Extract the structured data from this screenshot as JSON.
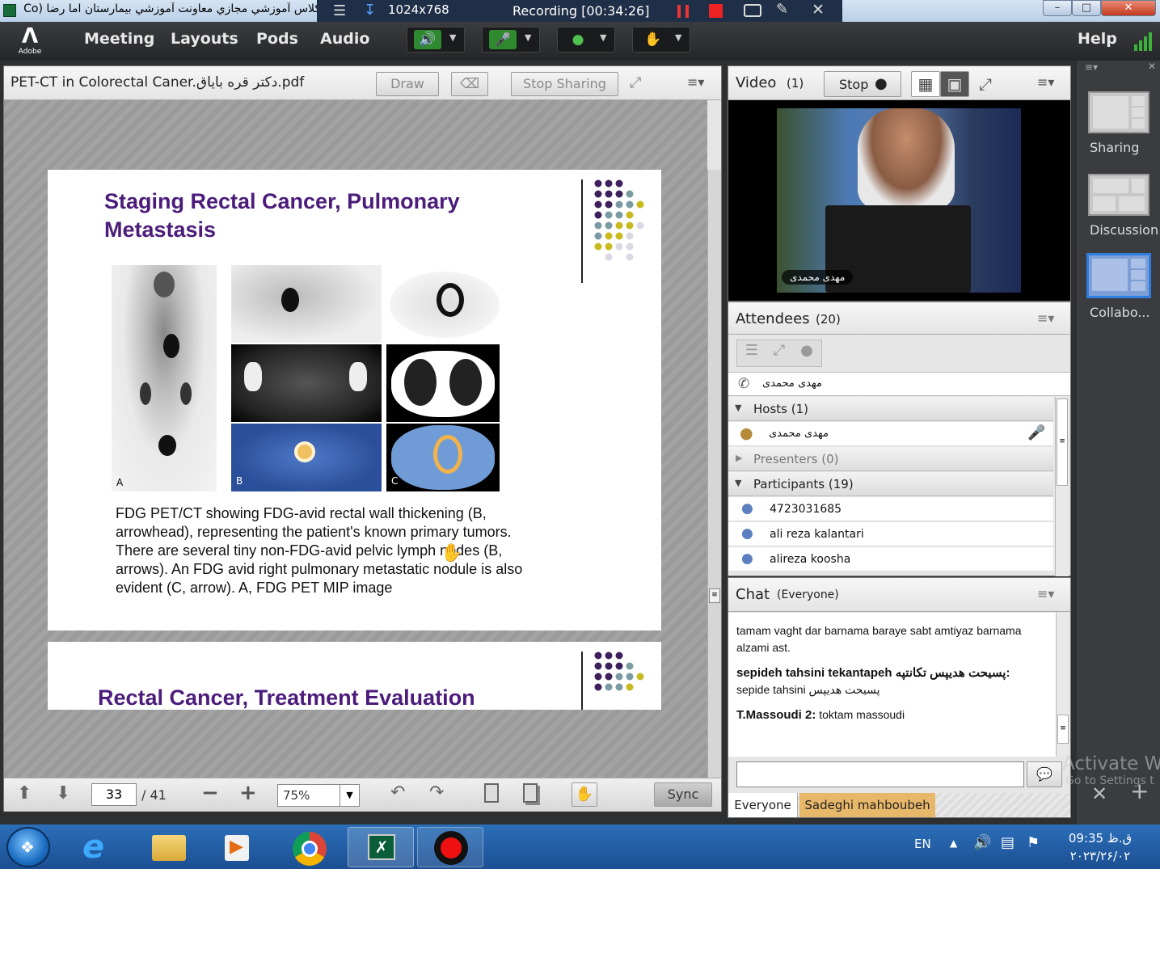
{
  "window": {
    "title": "كلاس آموزشي مجازي معاونت آموزشي بيمارستان اما رضا (Co",
    "resolution": "1024x768",
    "recording": "Recording [00:34:26]"
  },
  "menu": {
    "logo_text": "Adobe",
    "items": [
      "Meeting",
      "Layouts",
      "Pods",
      "Audio"
    ],
    "help": "Help"
  },
  "share_pod": {
    "title": "PET-CT in Colorectal Caner.دکتر قره باياق.pdf",
    "draw": "Draw",
    "stop_sharing": "Stop Sharing",
    "slide1": {
      "title_line1": "Staging Rectal Cancer, Pulmonary",
      "title_line2": "Metastasis",
      "label_a": "A",
      "label_b": "B",
      "label_c": "C",
      "caption_line1": "FDG PET/CT showing FDG-avid rectal wall thickening (B,",
      "caption_line2": "arrowhead), representing the patient's known primary tumors.",
      "caption_line3": "There are several tiny non-FDG-avid pelvic lymph nodes (B,",
      "caption_line4": "arrows). An FDG avid right pulmonary metastatic nodule is also",
      "caption_line5": "evident (C, arrow). A, FDG PET MIP image"
    },
    "slide2": {
      "title": "Rectal Cancer, Treatment Evaluation"
    },
    "page": "33",
    "total_pages": "/ 41",
    "zoom": "75%",
    "sync": "Sync"
  },
  "video_pod": {
    "title": "Video",
    "count": "(1)",
    "stop": "Stop",
    "name_tag": "مهدی محمدی"
  },
  "attendees_pod": {
    "title": "Attendees",
    "count": "(20)",
    "phone_user": "مهدی محمدی",
    "hosts": "Hosts (1)",
    "host_name": "مهدی محمدی",
    "presenters": "Presenters (0)",
    "participants": "Participants (19)",
    "participant_list": [
      "4723031685",
      "ali reza kalantari",
      "alireza koosha"
    ]
  },
  "chat_pod": {
    "title": "Chat",
    "scope": "(Everyone)",
    "messages": [
      {
        "sender": "",
        "text": "tamam vaght dar barnama baraye sabt amtiyaz barnama alzami ast."
      },
      {
        "sender": "sepideh tahsini tekantapeh پسيحت هدیپس تکانتپه:",
        "text": "sepide tahsini پسيحت هدیپس"
      },
      {
        "sender": "T.Massoudi 2:",
        "text": "toktam massoudi"
      }
    ],
    "tab_everyone": "Everyone",
    "tab_private": "Sadeghi mahboubeh"
  },
  "layouts_panel": {
    "items": [
      "Sharing",
      "Discussion",
      "Collabo..."
    ]
  },
  "watermark": {
    "line1": "Activate Wi",
    "line2": "Go to Settings t"
  },
  "taskbar": {
    "lang": "EN",
    "time": "09:35 ق.ظ",
    "date": "۲۰۲۳/۲۶/۰۲"
  }
}
